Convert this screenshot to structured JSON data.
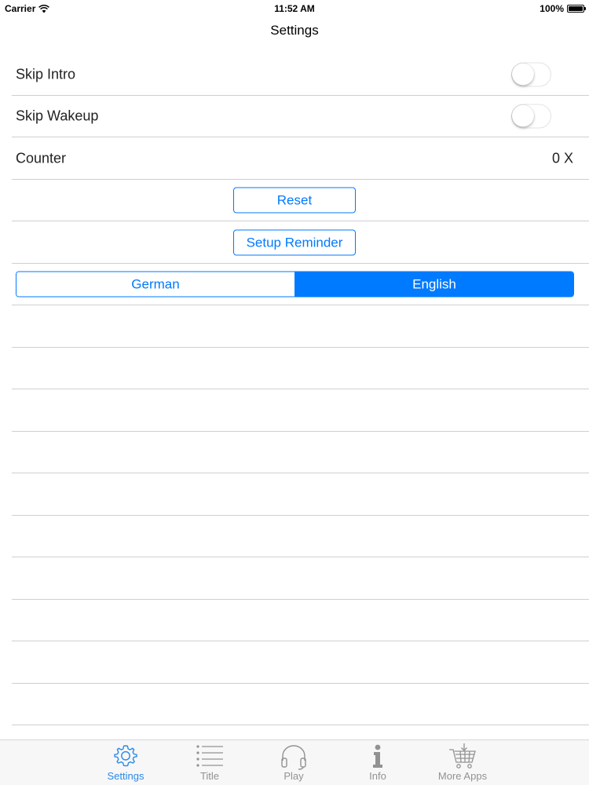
{
  "status_bar": {
    "carrier": "Carrier",
    "time": "11:52 AM",
    "battery": "100%"
  },
  "nav": {
    "title": "Settings"
  },
  "rows": {
    "skip_intro": {
      "label": "Skip Intro",
      "on": false
    },
    "skip_wakeup": {
      "label": "Skip Wakeup",
      "on": false
    },
    "counter": {
      "label": "Counter",
      "value": "0 X"
    },
    "reset": {
      "label": "Reset"
    },
    "setup_reminder": {
      "label": "Setup Reminder"
    },
    "language": {
      "options": [
        "German",
        "English"
      ],
      "selected": "English"
    }
  },
  "tab_bar": {
    "tabs": [
      {
        "label": "Settings",
        "icon": "gear-icon",
        "active": true
      },
      {
        "label": "Title",
        "icon": "list-icon",
        "active": false
      },
      {
        "label": "Play",
        "icon": "headphones-icon",
        "active": false
      },
      {
        "label": "Info",
        "icon": "info-icon",
        "active": false
      },
      {
        "label": "More Apps",
        "icon": "cart-icon",
        "active": false
      }
    ]
  },
  "colors": {
    "accent": "#007aff",
    "separator": "#cfcfd4",
    "tab_active": "#2a8ae6",
    "tab_inactive": "#929292"
  }
}
